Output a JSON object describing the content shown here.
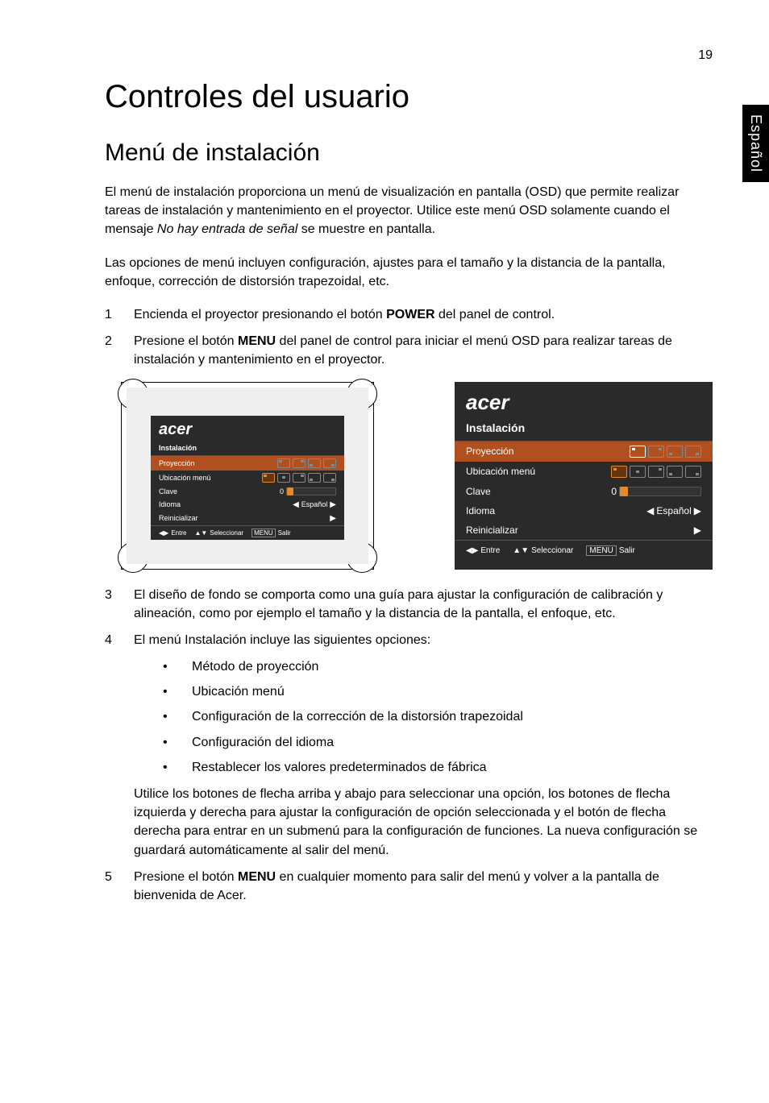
{
  "page_number": "19",
  "side_tab": "Español",
  "h1": "Controles del usuario",
  "h2": "Menú de instalación",
  "para1_a": "El menú de instalación proporciona un menú de visualización en pantalla (OSD) que permite realizar tareas de instalación y mantenimiento en el proyector. Utilice este menú OSD solamente cuando el mensaje ",
  "para1_italic": "No hay entrada de señal",
  "para1_b": " se muestre en pantalla.",
  "para2": "Las opciones de menú incluyen configuración, ajustes para el tamaño y la distancia de la pantalla, enfoque, corrección de distorsión trapezoidal, etc.",
  "steps": {
    "1": {
      "num": "1",
      "a": "Encienda el proyector presionando el botón ",
      "bold": "POWER",
      "b": " del panel de control."
    },
    "2": {
      "num": "2",
      "a": "Presione el botón ",
      "bold": "MENU",
      "b": " del panel de control para iniciar el menú OSD para realizar tareas de instalación y mantenimiento en el proyector."
    },
    "3": {
      "num": "3",
      "text": "El diseño de fondo se comporta como una guía para ajustar la configuración de calibración y alineación, como por ejemplo el tamaño y la distancia de la pantalla, el enfoque, etc."
    },
    "4": {
      "num": "4",
      "text": "El menú Instalación incluye las siguientes opciones:",
      "bullets": [
        "Método de proyección",
        "Ubicación menú",
        "Configuración de la corrección de la distorsión trapezoidal",
        "Configuración del idioma",
        "Restablecer los valores predeterminados de fábrica"
      ],
      "sub": "Utilice los botones de flecha arriba y abajo para seleccionar una opción, los botones de flecha izquierda y derecha para ajustar la configuración de opción seleccionada y el botón de flecha derecha para entrar en un submenú para la configuración de funciones. La nueva configuración se guardará automáticamente al salir del menú."
    },
    "5": {
      "num": "5",
      "a": "Presione el botón ",
      "bold": "MENU",
      "b": " en cualquier momento para salir del menú y volver a la pantalla de bienvenida de Acer."
    }
  },
  "osd": {
    "logo": "acer",
    "title": "Instalación",
    "rows": {
      "proyeccion": {
        "label": "Proyección"
      },
      "ubicacion": {
        "label": "Ubicación menú"
      },
      "clave": {
        "label": "Clave",
        "value": "0"
      },
      "idioma": {
        "label": "Idioma",
        "value": "Español"
      },
      "reinicializar": {
        "label": "Reinicializar"
      }
    },
    "footer": {
      "entre": "Entre",
      "seleccionar": "Seleccionar",
      "menu": "MENU",
      "salir": "Salir"
    }
  }
}
